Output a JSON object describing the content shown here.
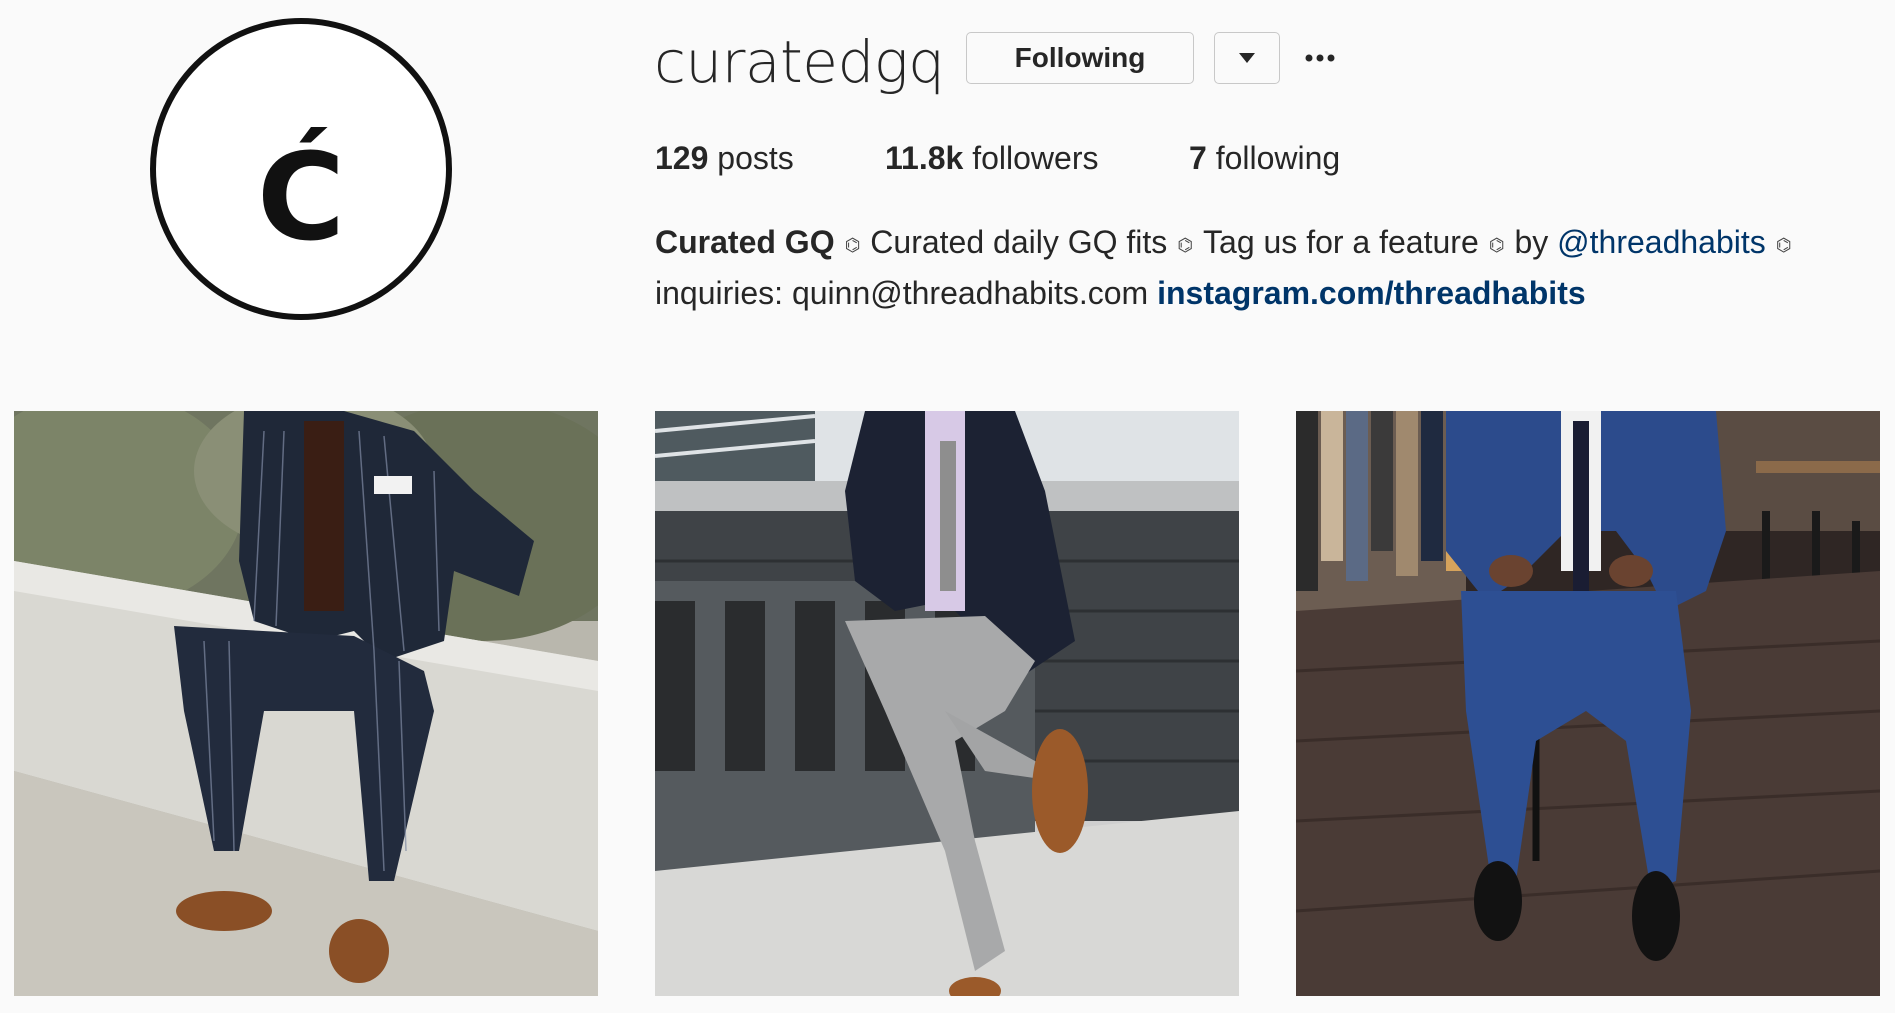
{
  "profile": {
    "username": "curatedgq",
    "avatar_icon": "curated-c-logo-icon",
    "avatar_letter": "Ć",
    "follow_button_label": "Following",
    "dropdown_icon": "caret-down-icon",
    "more_icon": "more-options-icon",
    "stats": {
      "posts_count": "129",
      "posts_label": "posts",
      "followers_count": "11.8k",
      "followers_label": "followers",
      "following_count": "7",
      "following_label": "following"
    },
    "bio": {
      "name": "Curated GQ",
      "separator": "⌬",
      "part1": "Curated daily GQ fits",
      "part2": "Tag us for a feature",
      "part3_prefix": "by",
      "mention": "@threadhabits",
      "inquiries": "inquiries: quinn@threadhabits.com",
      "link": "instagram.com/threadhabits"
    }
  },
  "posts": [
    {
      "subject": "man in navy pinstripe double-breasted suit sitting on ledge"
    },
    {
      "subject": "man in navy velvet blazer and grey trousers on wicker sofa"
    },
    {
      "subject": "man in blue suit seated on stool on wood floor"
    }
  ],
  "colors": {
    "background": "#fafafa",
    "text": "#262626",
    "link": "#003569",
    "button_border": "#c8c8c8"
  }
}
